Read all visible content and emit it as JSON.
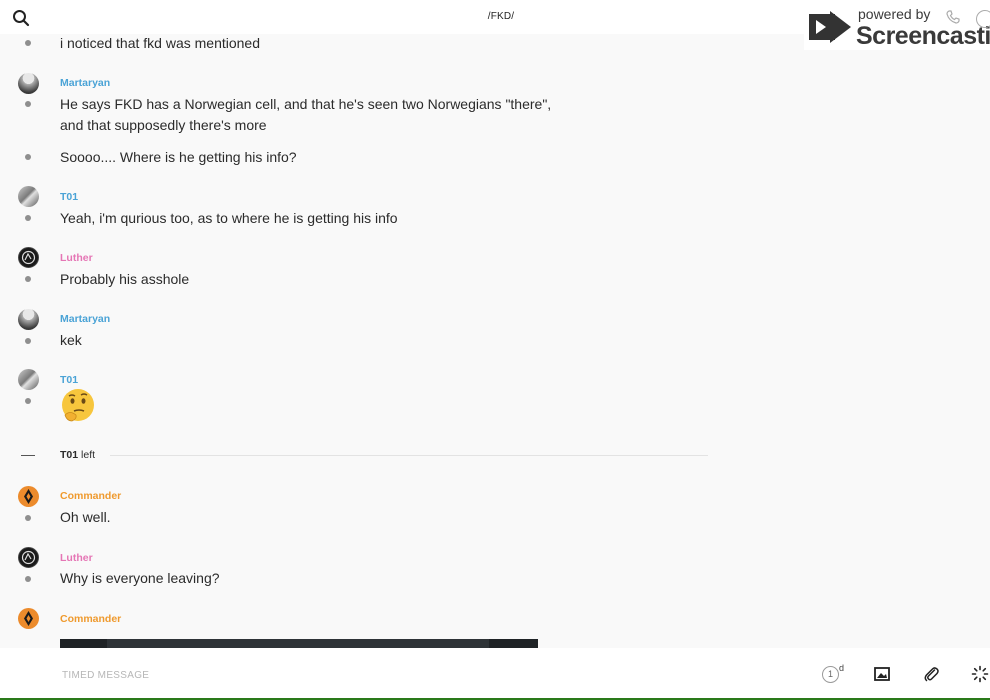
{
  "header": {
    "channel_title": "/FKD/",
    "watermark": {
      "powered_by": "powered by",
      "brand": "Screencastify"
    }
  },
  "colors": {
    "martaryan": "#4aa3d6",
    "t01": "#4aa3d6",
    "luther": "#e576b5",
    "commander": "#ef9a2e"
  },
  "messages": [
    {
      "text": "i noticed that fkd was mentioned"
    },
    {
      "author": "Martaryan",
      "text": "He says FKD has a Norwegian cell, and that he's seen two Norwegians \"there\",",
      "text2": "and that supposedly there's more"
    },
    {
      "text": "Soooo.... Where is he getting his info?"
    },
    {
      "author": "T01",
      "text": "Yeah, i'm qurious too, as to where he is getting his info"
    },
    {
      "author": "Luther",
      "text": "Probably his asshole"
    },
    {
      "author": "Martaryan",
      "text": "kek"
    },
    {
      "author": "T01",
      "emoji": "thinking-face-icon"
    },
    {
      "system": {
        "user": "T01",
        "action": "left"
      }
    },
    {
      "author": "Commander",
      "text": "Oh well."
    },
    {
      "author": "Luther",
      "text": "Why is everyone leaving?"
    },
    {
      "author": "Commander"
    }
  ],
  "composer": {
    "placeholder": "TIMED MESSAGE",
    "timer": {
      "value": "1",
      "unit": "d"
    },
    "icons": [
      "image-icon",
      "paperclip-icon",
      "loading-spinner-icon"
    ]
  }
}
